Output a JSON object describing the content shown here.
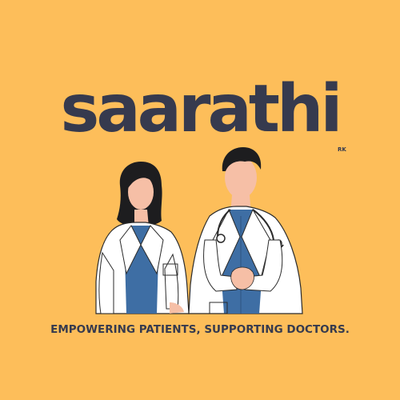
{
  "logo": {
    "wordmark": "saarathi",
    "sub_mark": "RK"
  },
  "tagline": "EMPOWERING PATIENTS, SUPPORTING DOCTORS.",
  "colors": {
    "background": "#FDBE5A",
    "text": "#363A4E",
    "coat": "#FFFFFF",
    "scrubs": "#3E6EA4",
    "skin": "#F6BFA6",
    "hair": "#1D1D1F"
  },
  "illustration": {
    "figures": [
      "female-doctor",
      "male-doctor"
    ]
  }
}
